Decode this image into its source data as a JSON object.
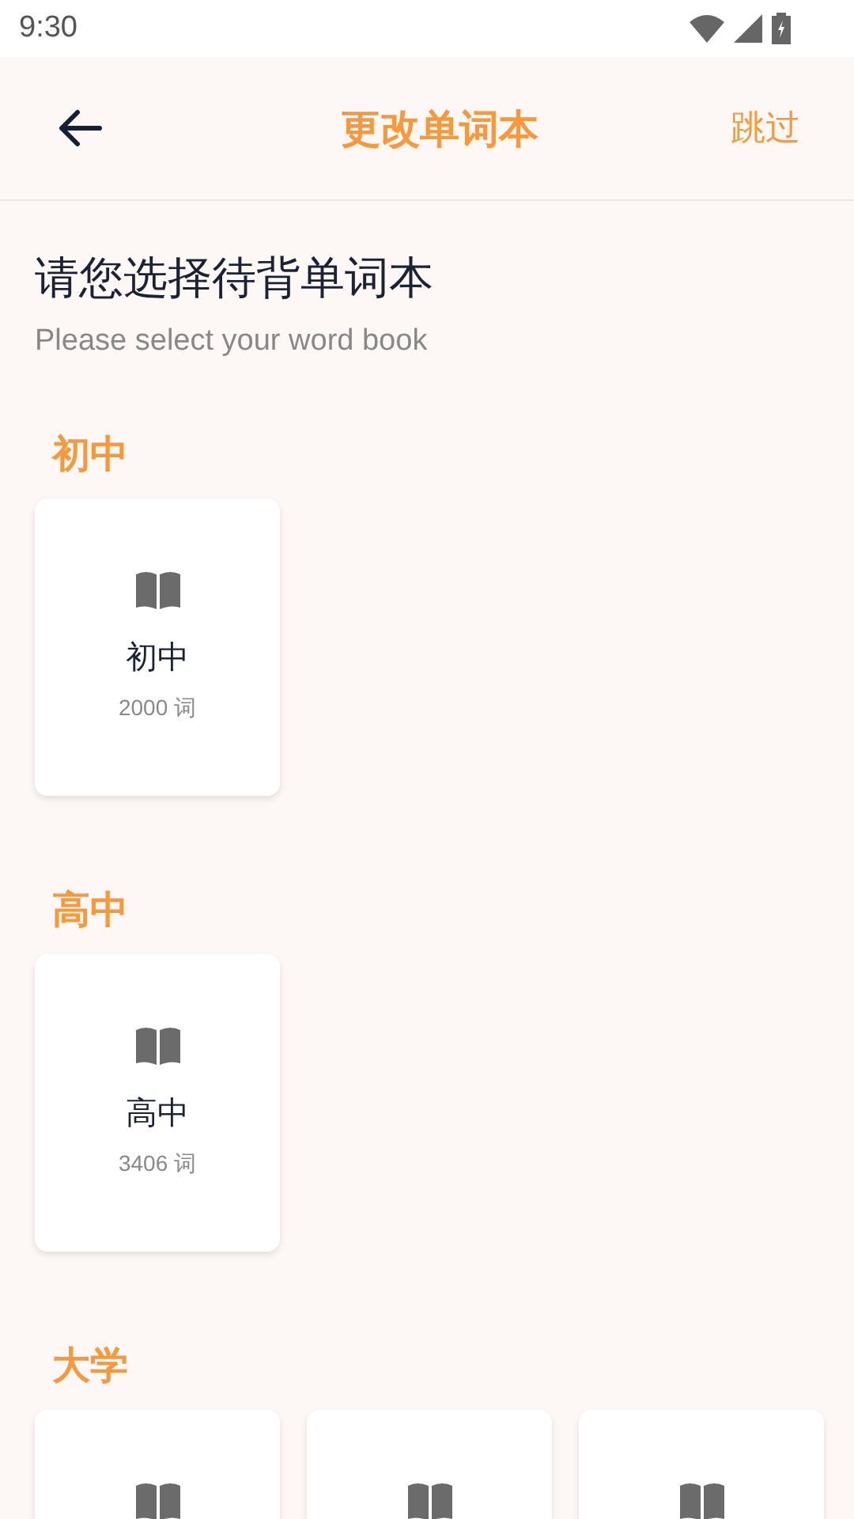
{
  "status_bar": {
    "time": "9:30"
  },
  "header": {
    "title": "更改单词本",
    "skip": "跳过"
  },
  "intro": {
    "title": "请您选择待背单词本",
    "subtitle": "Please select your word book"
  },
  "sections": [
    {
      "title": "初中",
      "books": [
        {
          "kind": "full",
          "title": "初中",
          "count": "2000 词"
        }
      ]
    },
    {
      "title": "高中",
      "books": [
        {
          "kind": "full",
          "title": "高中",
          "count": "3406 词"
        }
      ]
    },
    {
      "title": "大学",
      "books": [
        {
          "kind": "cut"
        },
        {
          "kind": "cut"
        },
        {
          "kind": "cut"
        }
      ]
    }
  ]
}
